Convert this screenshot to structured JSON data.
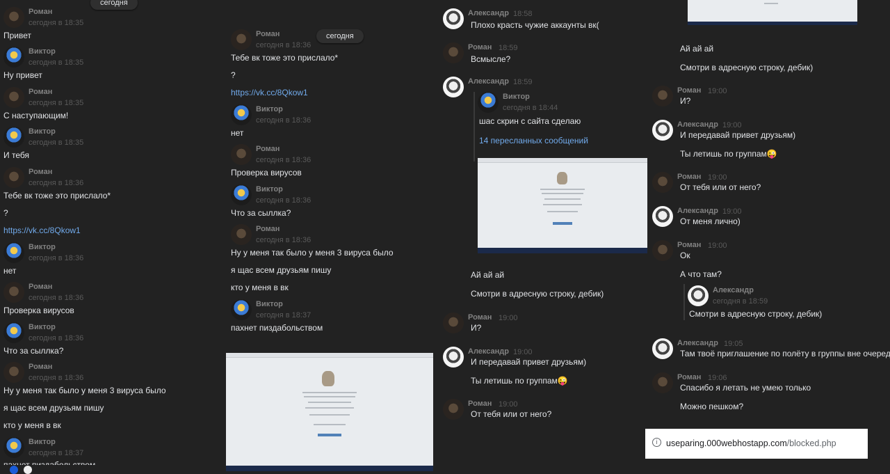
{
  "date_pill": "сегодня",
  "col1": [
    {
      "name": "Роман",
      "time": "сегодня в 18:35",
      "lines": [
        "Привет"
      ]
    },
    {
      "name": "Виктор",
      "time": "сегодня в 18:35",
      "lines": [
        "Ну привет"
      ]
    },
    {
      "name": "Роман",
      "time": "сегодня в 18:35",
      "lines": [
        "С наступающим!"
      ]
    },
    {
      "name": "Виктор",
      "time": "сегодня в 18:35",
      "lines": [
        "И тебя"
      ]
    },
    {
      "name": "Роман",
      "time": "сегодня в 18:36",
      "lines": [
        "Тебе вк тоже это прислало*",
        "?",
        "https://vk.cc/8Qkow1"
      ]
    },
    {
      "name": "Виктор",
      "time": "сегодня в 18:36",
      "lines": [
        "нет"
      ]
    },
    {
      "name": "Роман",
      "time": "сегодня в 18:36",
      "lines": [
        "Проверка вирусов"
      ]
    },
    {
      "name": "Виктор",
      "time": "сегодня в 18:36",
      "lines": [
        "Что за сыллка?"
      ]
    },
    {
      "name": "Роман",
      "time": "сегодня в 18:36",
      "lines": [
        "Ну у меня так было у меня 3 вируса было",
        "я щас всем друзьям пишу",
        "кто у меня в вк"
      ]
    },
    {
      "name": "Виктор",
      "time": "сегодня в 18:37",
      "lines": [
        "пахнет пиздабольством"
      ]
    }
  ],
  "col2": [
    {
      "name": "Роман",
      "time": "сегодня в 18:36",
      "lines": [
        "Тебе вк тоже это прислало*",
        "?",
        "https://vk.cc/8Qkow1"
      ]
    },
    {
      "name": "Виктор",
      "time": "сегодня в 18:36",
      "lines": [
        "нет"
      ]
    },
    {
      "name": "Роман",
      "time": "сегодня в 18:36",
      "lines": [
        "Проверка вирусов"
      ]
    },
    {
      "name": "Виктор",
      "time": "сегодня в 18:36",
      "lines": [
        "Что за сыллка?"
      ]
    },
    {
      "name": "Роман",
      "time": "сегодня в 18:36",
      "lines": [
        "Ну у меня так было у меня 3 вируса было",
        "я щас всем друзьям пишу",
        "кто у меня в вк"
      ]
    },
    {
      "name": "Виктор",
      "time": "сегодня в 18:37",
      "lines": [
        "пахнет пиздабольством"
      ]
    }
  ],
  "col3": [
    {
      "name": "Александр",
      "time": "18:58",
      "lines": [
        "Плохо красть чужие аккаунты вк("
      ]
    },
    {
      "name": "Роман",
      "time": "18:59",
      "lines": [
        "Всмысле?"
      ]
    },
    {
      "name": "Александр",
      "time": "18:59",
      "fwd": {
        "name": "Виктор",
        "time": "сегодня в 18:44",
        "text": "шас скрин с сайта сделаю",
        "more": "14 пересланных сообщений"
      },
      "lines": [
        "Ай ай ай",
        "Смотри в адресную строку, дебик)"
      ]
    },
    {
      "name": "Роман",
      "time": "19:00",
      "lines": [
        "И?"
      ]
    },
    {
      "name": "Александр",
      "time": "19:00",
      "lines": [
        "И передавай привет друзьям)",
        "Ты летишь по группам😜"
      ]
    },
    {
      "name": "Роман",
      "time": "19:00",
      "lines": [
        "От тебя или от него?"
      ]
    }
  ],
  "col4": [
    {
      "lines": [
        "Ай ай ай",
        "Смотри в адресную строку, дебик)"
      ]
    },
    {
      "name": "Роман",
      "time": "19:00",
      "lines": [
        "И?"
      ]
    },
    {
      "name": "Александр",
      "time": "19:00",
      "lines": [
        "И передавай привет друзьям)",
        "Ты летишь по группам😜"
      ]
    },
    {
      "name": "Роман",
      "time": "19:00",
      "lines": [
        "От тебя или от него?"
      ]
    },
    {
      "name": "Александр",
      "time": "19:00",
      "lines": [
        "От меня лично)"
      ]
    },
    {
      "name": "Роман",
      "time": "19:00",
      "lines": [
        "Ок",
        "А что там?"
      ]
    },
    {
      "fwd": {
        "name": "Александр",
        "time": "сегодня в 18:59",
        "text": "Смотри в адресную строку, дебик)"
      }
    },
    {
      "name": "Александр",
      "time": "19:05",
      "lines": [
        "Там твоё приглашение по полёту в группы вне очереди)"
      ]
    },
    {
      "name": "Роман",
      "time": "19:06",
      "lines": [
        "Спасибо я летать не умею только",
        "Можно пешком?"
      ]
    }
  ],
  "url": {
    "host": "useparing.000webhostapp.com",
    "path": "/blocked.php"
  }
}
